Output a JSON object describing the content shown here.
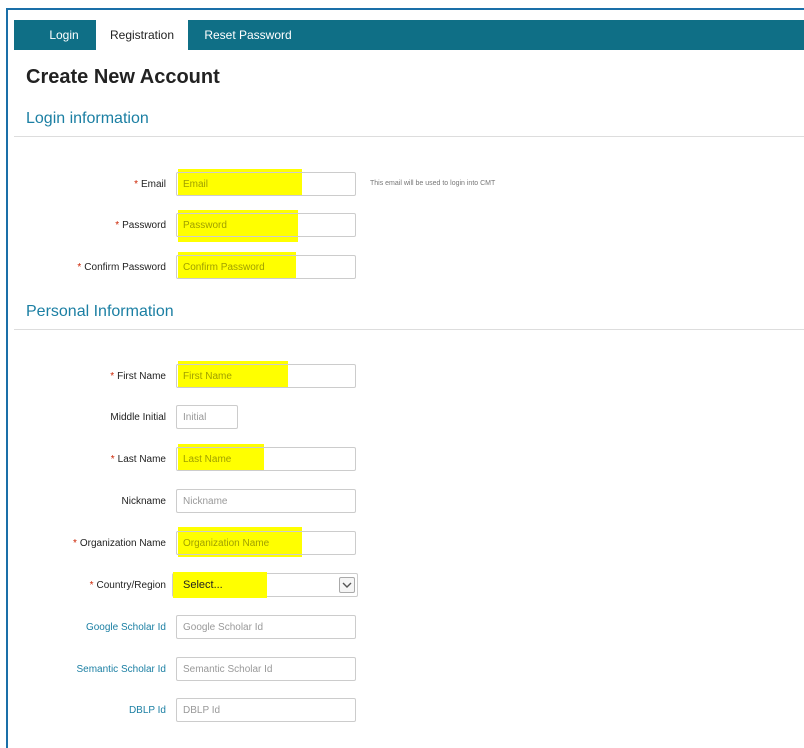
{
  "tabs": [
    {
      "label": "Login",
      "active": false
    },
    {
      "label": "Registration",
      "active": true
    },
    {
      "label": "Reset Password",
      "active": false
    }
  ],
  "page_title": "Create New Account",
  "sections": {
    "login": "Login information",
    "personal": "Personal Information"
  },
  "required_marker": "*",
  "fields": {
    "email": {
      "label": "Email",
      "placeholder": "Email",
      "hint": "This email will be used to login into CMT"
    },
    "password": {
      "label": "Password",
      "placeholder": "Password"
    },
    "confirm_password": {
      "label": "Confirm Password",
      "placeholder": "Confirm Password"
    },
    "first_name": {
      "label": "First Name",
      "placeholder": "First Name"
    },
    "middle_initial": {
      "label": "Middle Initial",
      "placeholder": "Initial"
    },
    "last_name": {
      "label": "Last Name",
      "placeholder": "Last Name"
    },
    "nickname": {
      "label": "Nickname",
      "placeholder": "Nickname"
    },
    "organization": {
      "label": "Organization Name",
      "placeholder": "Organization Name"
    },
    "country": {
      "label": "Country/Region",
      "value": "Select..."
    },
    "google_scholar": {
      "label": "Google Scholar Id",
      "placeholder": "Google Scholar Id"
    },
    "semantic_scholar": {
      "label": "Semantic Scholar Id",
      "placeholder": "Semantic Scholar Id"
    },
    "dblp": {
      "label": "DBLP Id",
      "placeholder": "DBLP Id"
    }
  },
  "colors": {
    "tab_bar": "#0f6f86",
    "section_title": "#1b7fa3",
    "required": "#cc2200",
    "highlight": "#ffff00"
  },
  "icons": {
    "country_dropdown": "chevron-down-icon"
  }
}
